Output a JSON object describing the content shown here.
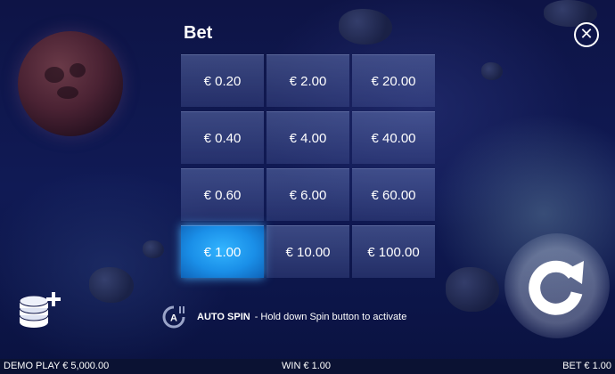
{
  "header": {
    "title": "Bet"
  },
  "close": {
    "symbol": "✕"
  },
  "bets": [
    {
      "label": "€ 0.20",
      "selected": false
    },
    {
      "label": "€ 2.00",
      "selected": false
    },
    {
      "label": "€ 20.00",
      "selected": false
    },
    {
      "label": "€ 0.40",
      "selected": false
    },
    {
      "label": "€ 4.00",
      "selected": false
    },
    {
      "label": "€ 40.00",
      "selected": false
    },
    {
      "label": "€ 0.60",
      "selected": false
    },
    {
      "label": "€ 6.00",
      "selected": false
    },
    {
      "label": "€ 60.00",
      "selected": false
    },
    {
      "label": "€ 1.00",
      "selected": true
    },
    {
      "label": "€ 10.00",
      "selected": false
    },
    {
      "label": "€ 100.00",
      "selected": false
    }
  ],
  "autospin": {
    "icon_letter": "A",
    "label": "AUTO SPIN",
    "hint": "- Hold down Spin button to activate"
  },
  "footer": {
    "balance": "DEMO PLAY € 5,000.00",
    "win": "WIN € 1.00",
    "bet": "BET € 1.00"
  },
  "colors": {
    "selected": "#1a8fe8",
    "background": "#101a55"
  }
}
